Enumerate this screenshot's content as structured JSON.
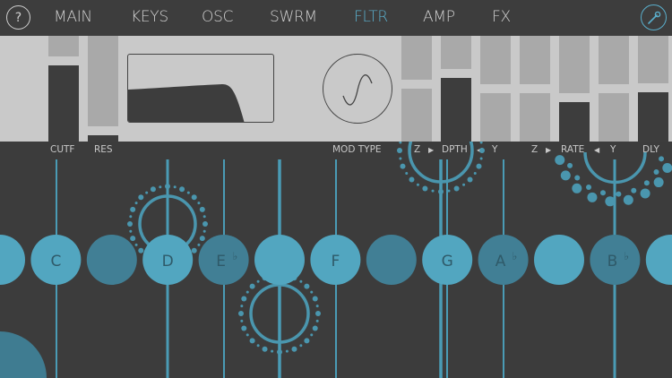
{
  "header": {
    "help_label": "?",
    "tabs": [
      {
        "label": "MAIN"
      },
      {
        "label": "KEYS"
      },
      {
        "label": "OSC"
      },
      {
        "label": "SWRM"
      },
      {
        "label": "FLTR",
        "active": true
      },
      {
        "label": "AMP"
      },
      {
        "label": "FX"
      }
    ]
  },
  "filter": {
    "cutoff": {
      "label": "CUTF",
      "value": 0.72
    },
    "resonance": {
      "label": "RES",
      "value": 0.06
    },
    "mod_type_label": "MOD TYPE",
    "mod_type_icon": "sine-wave-icon"
  },
  "mod_sliders": {
    "values": [
      0.5,
      0.6,
      0.46,
      0.46,
      0.37,
      0.46,
      0.47
    ],
    "active": [
      false,
      true,
      false,
      false,
      true,
      false,
      true
    ],
    "depth": {
      "z": "Z",
      "label": "DPTH",
      "y": "Y"
    },
    "rate": {
      "z": "Z",
      "label": "RATE",
      "y": "Y"
    },
    "delay": {
      "label": "DLY"
    }
  },
  "keys": [
    {
      "note": "",
      "flat": "",
      "lit": true
    },
    {
      "note": "C",
      "flat": "",
      "lit": true
    },
    {
      "note": "",
      "flat": "",
      "lit": false
    },
    {
      "note": "D",
      "flat": "",
      "lit": true
    },
    {
      "note": "E",
      "flat": "♭",
      "lit": false
    },
    {
      "note": "",
      "flat": "",
      "lit": true
    },
    {
      "note": "F",
      "flat": "",
      "lit": true
    },
    {
      "note": "",
      "flat": "",
      "lit": false
    },
    {
      "note": "G",
      "flat": "",
      "lit": true
    },
    {
      "note": "A",
      "flat": "♭",
      "lit": false
    },
    {
      "note": "",
      "flat": "",
      "lit": true
    },
    {
      "note": "B",
      "flat": "♭",
      "lit": false
    },
    {
      "note": "",
      "flat": "",
      "lit": true
    }
  ],
  "colors": {
    "accent": "#5aaecb",
    "key_lit": "#52a6c0",
    "key_dim": "#417f95",
    "background": "#3c3c3c",
    "panel": "#c9c9c9",
    "slider_track": "#a9a9a9",
    "slider_fill": "#3d3d3d"
  }
}
